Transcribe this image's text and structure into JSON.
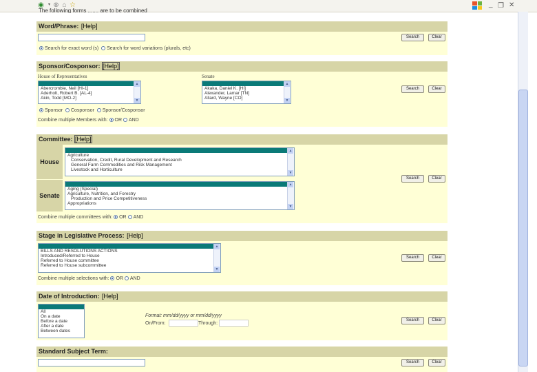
{
  "browser": {
    "toolbar_icons": [
      "back-icon",
      "dropdown-icon",
      "stop-icon",
      "home-icon",
      "favorite-star-icon"
    ],
    "window_controls": [
      "minimize-icon",
      "restore-icon",
      "close-icon"
    ],
    "brand": "windows-logo"
  },
  "cropped_intro": "The following forms ....... are to be combined",
  "word_phrase": {
    "title": "Word/Phrase:",
    "help": "[Help]",
    "input_value": "",
    "search_label": "Search",
    "clear_label": "Clear",
    "options": [
      "Search for exact word (s)",
      "Search for word variations (plurals, etc)"
    ]
  },
  "sponsor": {
    "title": "Sponsor/Cosponsor:",
    "help": "[Help]",
    "house_label": "House of Representatives",
    "senate_label": "Senate",
    "house_items": [
      "",
      "Abercrombie, Neil [HI-1]",
      "Aderholt, Robert B. [AL-4]",
      "Akin, Todd [MO-2]"
    ],
    "senate_items": [
      "",
      "Akaka, Daniel K. [HI]",
      "Alexander, Lamar [TN]",
      "Allard, Wayne [CO]"
    ],
    "search_label": "Search",
    "clear_label": "Clear",
    "role_options": [
      "Sponsor",
      "Cosponsor",
      "Sponsor/Cosponsor"
    ],
    "combine_label": "Combine multiple Members with:",
    "combine_or": "OR",
    "combine_and": "AND"
  },
  "committee": {
    "title": "Committee:",
    "help": "[Help]",
    "house_label": "House",
    "senate_label": "Senate",
    "house_items": [
      "",
      "Agriculture",
      "Conservation, Credit, Rural Development and Research",
      "General Farm Commodities and Risk Management",
      "Livestock and Horticulture"
    ],
    "senate_items": [
      "",
      "Aging (Special)",
      "Agriculture, Nutrition, and Forestry",
      "Production and Price Competitiveness",
      "Appropriations"
    ],
    "search_label": "Search",
    "clear_label": "Clear",
    "combine_label": "Combine multiple committees with:",
    "combine_or": "OR",
    "combine_and": "AND"
  },
  "stage": {
    "title": "Stage in Legislative Process:",
    "help": "[Help]",
    "items": [
      "",
      "BILLS AND RESOLUTIONS ACTIONS",
      "Introduced/Referred to House",
      "Referred to House committee",
      "Referred to House subcommittee"
    ],
    "search_label": "Search",
    "clear_label": "Clear",
    "combine_label": "Combine multiple selections with:",
    "combine_or": "OR",
    "combine_and": "AND"
  },
  "date_intro": {
    "title": "Date of Introduction:",
    "help": "[Help]",
    "items": [
      "",
      "All",
      "On a date",
      "Before a date",
      "After a date",
      "Between dates"
    ],
    "format_label": "Format: mm/dd/yyyy or mm/dd/yyyy",
    "on_from_label": "On/From:",
    "through_label": "Through:",
    "search_label": "Search",
    "clear_label": "Clear"
  },
  "subject": {
    "title": "Standard Subject Term:",
    "search_label": "Search",
    "clear_label": "Clear"
  },
  "colors": {
    "header_bg": "#d7d5a7",
    "body_bg": "#ffffd6",
    "selected_option": "#0a7a78"
  }
}
